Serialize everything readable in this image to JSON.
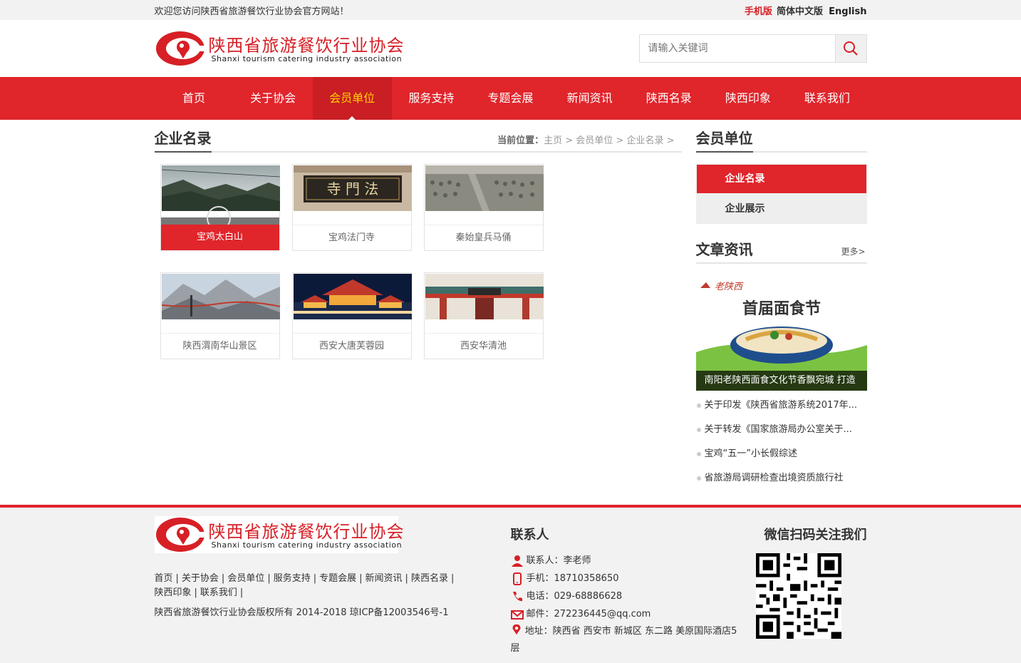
{
  "topbar": {
    "welcome": "欢迎您访问陕西省旅游餐饮行业协会官方网站！",
    "mobile": "手机版",
    "chinese": "简体中文版",
    "english": "English"
  },
  "brand": {
    "name_cn": "陕西省旅游餐饮行业协会",
    "name_en": "Shanxi tourism catering industry association",
    "color": "#e0252b"
  },
  "search": {
    "placeholder": "请输入关键词",
    "icon": "search-icon"
  },
  "nav": {
    "items": [
      {
        "label": "首页"
      },
      {
        "label": "关于协会"
      },
      {
        "label": "会员单位"
      },
      {
        "label": "服务支持"
      },
      {
        "label": "专题会展"
      },
      {
        "label": "新闻资讯"
      },
      {
        "label": "陕西名录"
      },
      {
        "label": "陕西印象"
      },
      {
        "label": "联系我们"
      }
    ]
  },
  "content": {
    "title": "企业名录",
    "breadcrumb": {
      "prefix": "当前位置：",
      "items": [
        "主页",
        "会员单位",
        "企业名录"
      ]
    },
    "cards": [
      {
        "label": "宝鸡太白山"
      },
      {
        "label": "宝鸡法门寺"
      },
      {
        "label": "秦始皇兵马俑"
      },
      {
        "label": "陕西渭南华山景区"
      },
      {
        "label": "西安大唐芙蓉园"
      },
      {
        "label": "西安华清池"
      }
    ],
    "plaque_text": "寺 門 法"
  },
  "sidebar": {
    "title": "会员单位",
    "menu": [
      {
        "label": "企业名录"
      },
      {
        "label": "企业展示"
      }
    ],
    "news": {
      "title": "文章资讯",
      "more": "更多>",
      "featured_caption": "南阳老陕西面食文化节香飘宛城 打造",
      "featured_brand": "老陕西",
      "featured_headline": "首届面食节",
      "items": [
        {
          "text": "关于印发《陕西省旅游系统2017年..."
        },
        {
          "text": "关于转发《国家旅游局办公室关于..."
        },
        {
          "text": "宝鸡“五一”小长假综述"
        },
        {
          "text": "省旅游局调研检查出境资质旅行社"
        }
      ]
    }
  },
  "footer": {
    "links": [
      "首页",
      "关于协会",
      "会员单位",
      "服务支持",
      "专题会展",
      "新闻资讯",
      "陕西名录",
      "陕西印象",
      "联系我们"
    ],
    "copyright": "陕西省旅游餐饮行业协会版权所有 2014-2018 琼ICP备12003546号-1",
    "contact": {
      "title": "联系人",
      "person": "联系人：李老师",
      "mobile": "手机：18710358650",
      "phone": "电话：029-68886628",
      "email": "邮件：272236445@qq.com",
      "address": "地址：陕西省 西安市 新城区 东二路 美原国际酒店5层"
    },
    "wechat": {
      "title": "微信扫码关注我们"
    }
  }
}
